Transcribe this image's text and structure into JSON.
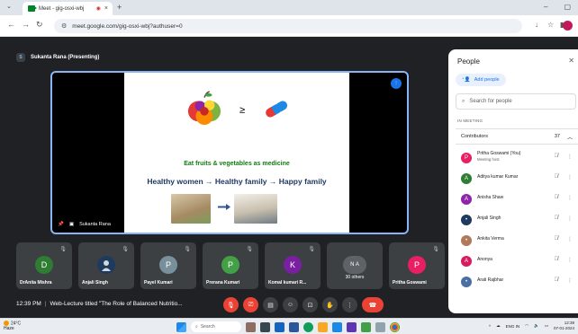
{
  "browser": {
    "tab_title": "Meet - gig-osxi-wbj",
    "url": "meet.google.com/gig-osxi-wbj?authuser=0",
    "new_tab": "+",
    "close": "×",
    "minimize": "–",
    "restore": "▢"
  },
  "meeting": {
    "presenting_label": "Sukanta Rana (Presenting)",
    "presenting_initial": "S",
    "stage_name": "Sukanta Rana",
    "time": "12:39 PM",
    "title": "Web-Lecture titled \"The Role of Balanced Nutritio..."
  },
  "slide": {
    "symbol": "≥",
    "tagline": "Eat fruits & vegetables as medicine",
    "headline": "Healthy women → Healthy family → Happy family",
    "arrow": "➡"
  },
  "tiles": [
    {
      "name": "DrAnita Mishra",
      "initial": "D",
      "color": "#2e7d32"
    },
    {
      "name": "Anjali Singh",
      "initial": "",
      "color": "#1e3a5f"
    },
    {
      "name": "Payel Kumari",
      "initial": "P",
      "color": "#78909c"
    },
    {
      "name": "Prerana Kumari",
      "initial": "P",
      "color": "#43a047"
    },
    {
      "name": "Komal kumari R...",
      "initial": "K",
      "color": "#7b1fa2"
    },
    {
      "name": "30 others",
      "initial": "N A",
      "color": "#5f6368"
    },
    {
      "name": "Pritha Goswami",
      "initial": "P",
      "color": "#e91e63"
    }
  ],
  "panel": {
    "title": "People",
    "add_people": "Add people",
    "search_placeholder": "Search for people",
    "section": "IN MEETING",
    "group": "Contributors",
    "group_count": "37",
    "participant_badge": "37",
    "people": [
      {
        "name": "Pritha Goswami (You)",
        "sub": "Meeting host",
        "initial": "P",
        "color": "#e91e63"
      },
      {
        "name": "Aditya kumar Kumar",
        "sub": "",
        "initial": "A",
        "color": "#2e7d32"
      },
      {
        "name": "Anisha Shaw",
        "sub": "",
        "initial": "A",
        "color": "#8e24aa"
      },
      {
        "name": "Anjali Singh",
        "sub": "",
        "initial": "",
        "color": "#1e3a5f"
      },
      {
        "name": "Ankita Verma",
        "sub": "",
        "initial": "",
        "color": "#b07a5a"
      },
      {
        "name": "Anonya",
        "sub": "",
        "initial": "A",
        "color": "#d81b60"
      },
      {
        "name": "Arati Rajbhar",
        "sub": "",
        "initial": "",
        "color": "#4a6fa5"
      }
    ]
  },
  "taskbar": {
    "temp": "24°C",
    "weather": "Haze",
    "search": "Search",
    "lang": "ENG",
    "region": "IN",
    "clock_time": "12:39",
    "clock_date": "07-01-2024"
  },
  "colors": {
    "meet_bg": "#202124",
    "tile_bg": "#3c4043",
    "accent": "#8ab4f8",
    "danger": "#ea4335"
  }
}
